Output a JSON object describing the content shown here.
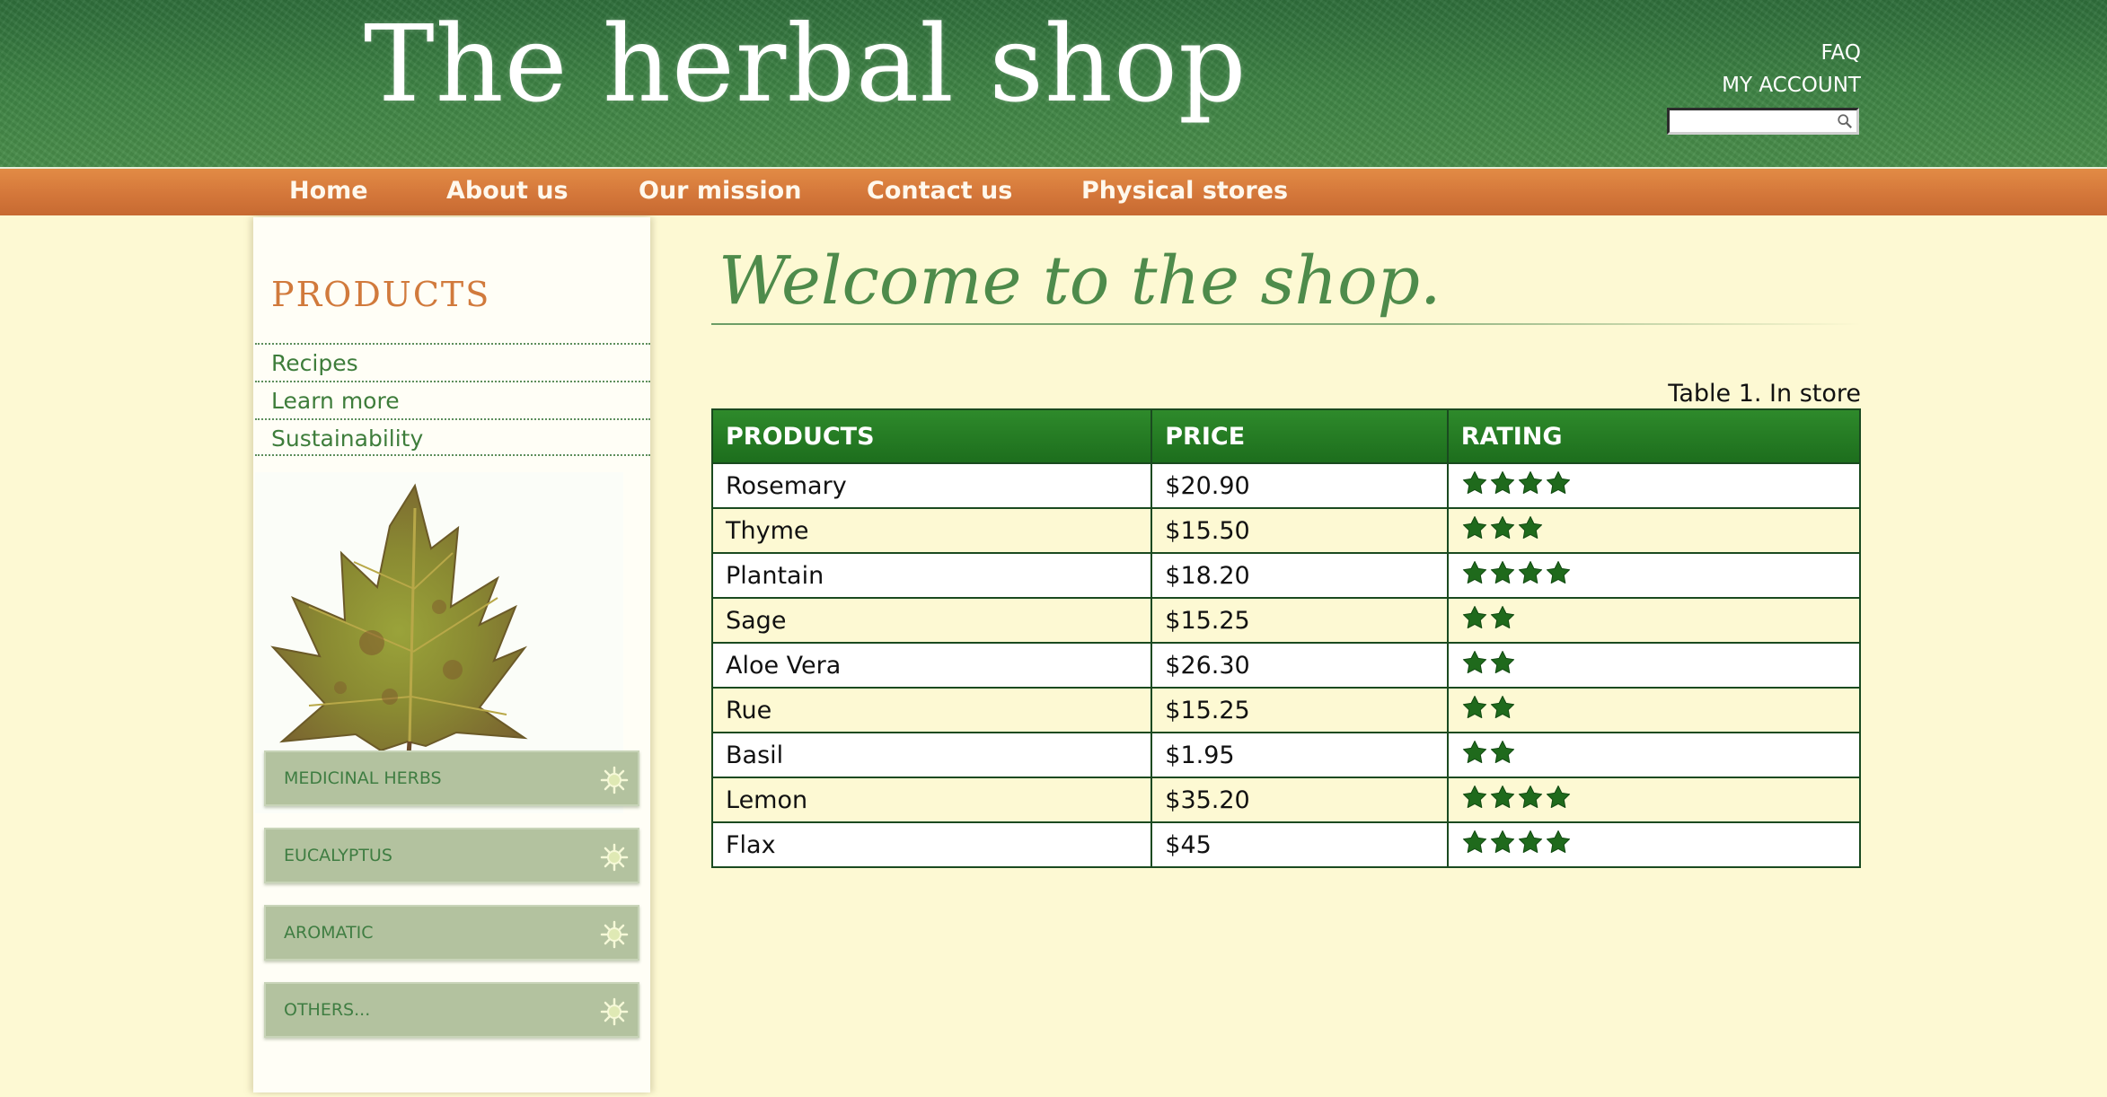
{
  "header": {
    "site_title": "The herbal shop",
    "faq": "FAQ",
    "my_account": "MY ACCOUNT",
    "search": {
      "value": "",
      "placeholder": ""
    }
  },
  "nav": {
    "items": [
      {
        "label": "Home"
      },
      {
        "label": "About us"
      },
      {
        "label": "Our mission"
      },
      {
        "label": "Contact us"
      },
      {
        "label": "Physical stores"
      }
    ]
  },
  "sidebar": {
    "heading": "PRODUCTS",
    "links": [
      "Recipes",
      "Learn more",
      "Sustainability"
    ],
    "categories": [
      "MEDICINAL HERBS",
      "EUCALYPTUS",
      "AROMATIC",
      "OTHERS..."
    ]
  },
  "main": {
    "welcome": "Welcome to the shop.",
    "table_caption": "Table 1. In store",
    "columns": [
      "PRODUCTS",
      "PRICE",
      "RATING"
    ],
    "rows": [
      {
        "product": "Rosemary",
        "price": "$20.90",
        "rating": 4
      },
      {
        "product": "Thyme",
        "price": "$15.50",
        "rating": 3
      },
      {
        "product": "Plantain",
        "price": "$18.20",
        "rating": 4
      },
      {
        "product": "Sage",
        "price": "$15.25",
        "rating": 2
      },
      {
        "product": "Aloe Vera",
        "price": "$26.30",
        "rating": 2
      },
      {
        "product": "Rue",
        "price": "$15.25",
        "rating": 2
      },
      {
        "product": "Basil",
        "price": "$1.95",
        "rating": 2
      },
      {
        "product": "Lemon",
        "price": "$35.20",
        "rating": 4
      },
      {
        "product": "Flax",
        "price": "$45",
        "rating": 4
      }
    ]
  },
  "colors": {
    "header_green": "#3f8445",
    "nav_orange": "#d4773a",
    "page_background": "#fdf9d3",
    "table_header_green": "#1d6e1d",
    "star_green": "#1f6a1c",
    "products_heading_orange": "#d17a3c"
  },
  "icons": {
    "search": "magnifier-icon",
    "category": "sun-gear-icon",
    "rating": "star-icon",
    "sidebar_image": "maple-leaf-icon"
  }
}
